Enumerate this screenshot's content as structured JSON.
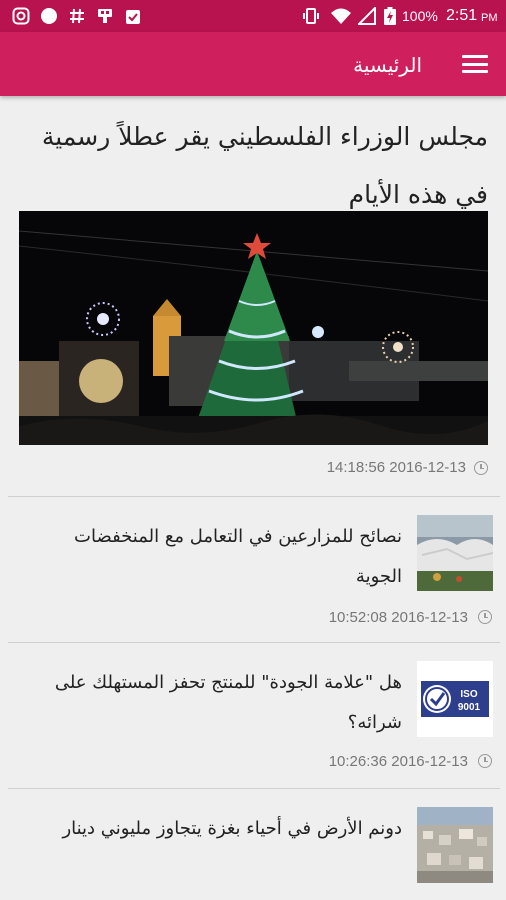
{
  "status_bar": {
    "battery": "100%",
    "time": "2:51",
    "ampm": "PM",
    "icons": [
      "instagram-icon",
      "circle-notification-icon",
      "hashtag-icon",
      "app-icon",
      "clipboard-check-icon",
      "vibrate-icon",
      "wifi-icon",
      "signal-icon",
      "battery-charging-icon"
    ]
  },
  "app_bar": {
    "title": "الرئيسية",
    "menu_icon": "hamburger-menu-icon"
  },
  "feature": {
    "title": "مجلس الوزراء الفلسطيني يقر عطلاً رسمية في هذه الأيام",
    "timestamp": "14:18:56 2016-12-13",
    "image": "christmas-tree-night-photo"
  },
  "articles": [
    {
      "title": "نصائح للمزارعين في التعامل مع المنخفضات الجوية",
      "timestamp": "10:52:08 2016-12-13",
      "image": "greenhouse-photo"
    },
    {
      "title": "هل \"علامة الجودة\" للمنتج تحفز المستهلك على شرائه؟",
      "timestamp": "10:26:36 2016-12-13",
      "image": "iso-9001-logo"
    },
    {
      "title": "دونم الأرض في أحياء بغزة يتجاوز مليوني دينار",
      "image": "aerial-city-photo"
    }
  ],
  "colors": {
    "status_bar": "#b8134f",
    "app_bar": "#cf1f5d",
    "background": "#efefef"
  }
}
